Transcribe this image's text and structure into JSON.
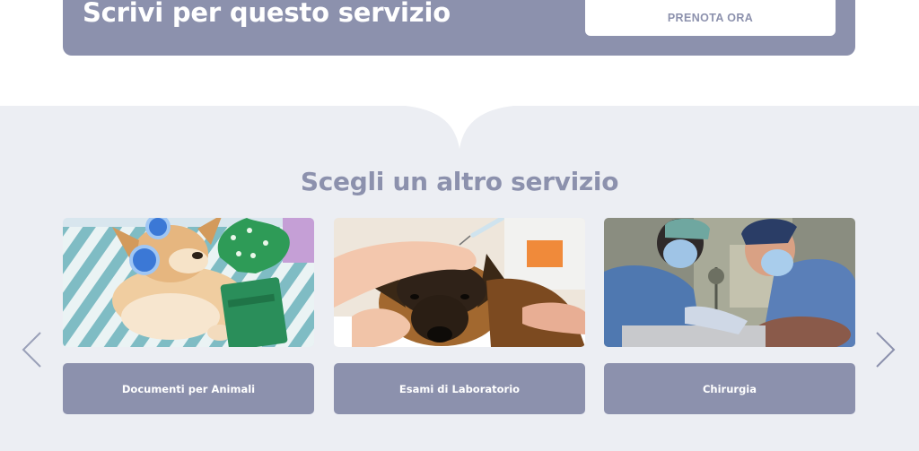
{
  "cta": {
    "title": "Scrivi per questo servizio",
    "button_label": "PRENOTA ORA"
  },
  "services_section": {
    "title": "Scegli un altro servizio",
    "cards": [
      {
        "label": "Documenti per Animali",
        "image": "dog-with-passport-photo"
      },
      {
        "label": "Esami di Laboratorio",
        "image": "german-shepherd-vet-exam-photo"
      },
      {
        "label": "Chirurgia",
        "image": "surgeons-operating-photo"
      }
    ],
    "prev_icon": "chevron-left-icon",
    "next_icon": "chevron-right-icon"
  },
  "colors": {
    "accent": "#8c91ad",
    "section_background": "#eceef3",
    "white": "#ffffff"
  }
}
